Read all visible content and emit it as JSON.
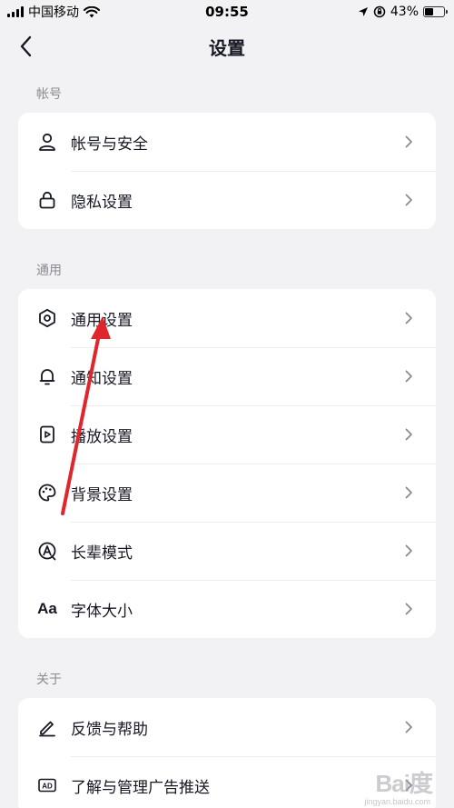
{
  "status_bar": {
    "carrier": "中国移动",
    "time": "09:55",
    "battery_percent": "43%",
    "battery_level": 0.43
  },
  "nav": {
    "title": "设置",
    "back_icon": "chevron-left-icon"
  },
  "sections": {
    "account": {
      "header": "帐号",
      "items": [
        {
          "label": "帐号与安全",
          "icon": "person-icon"
        },
        {
          "label": "隐私设置",
          "icon": "lock-icon"
        }
      ]
    },
    "general": {
      "header": "通用",
      "items": [
        {
          "label": "通用设置",
          "icon": "gear-icon"
        },
        {
          "label": "通知设置",
          "icon": "bell-icon"
        },
        {
          "label": "播放设置",
          "icon": "play-file-icon"
        },
        {
          "label": "背景设置",
          "icon": "palette-icon"
        },
        {
          "label": "长辈模式",
          "icon": "elder-mode-icon"
        },
        {
          "label": "字体大小",
          "icon": "font-size-icon",
          "icon_text": "Aa"
        }
      ]
    },
    "about": {
      "header": "关于",
      "items": [
        {
          "label": "反馈与帮助",
          "icon": "pen-icon"
        },
        {
          "label": "了解与管理广告推送",
          "icon": "ad-icon",
          "icon_text": "AD"
        }
      ]
    }
  },
  "colors": {
    "background": "#f2f2f4",
    "card": "#ffffff",
    "text": "#161823",
    "secondary_text": "#8a8b91",
    "annotation_arrow": "#e0262d"
  },
  "watermark": {
    "brand": "Bai度",
    "url": "jingyan.baidu.com"
  }
}
